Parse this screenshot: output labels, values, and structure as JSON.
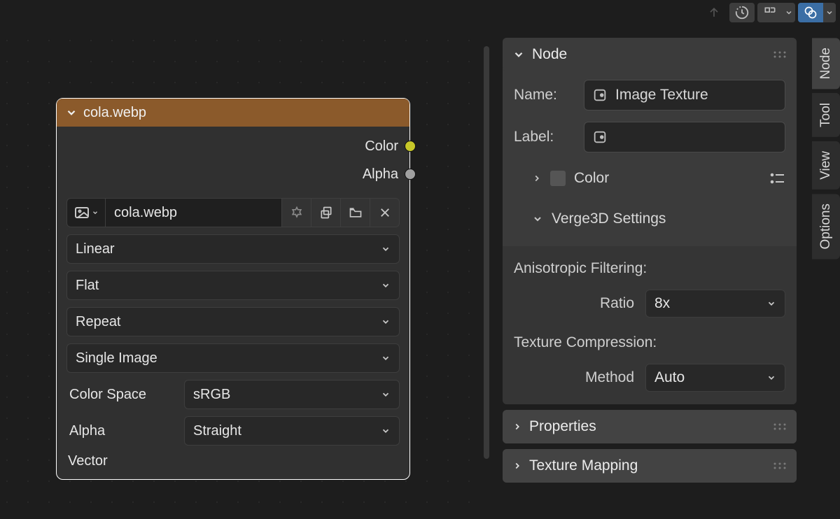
{
  "node": {
    "title": "cola.webp",
    "outputs": {
      "color": "Color",
      "alpha": "Alpha"
    },
    "image_field": "cola.webp",
    "interpolation": "Linear",
    "projection": "Flat",
    "extension": "Repeat",
    "source": "Single Image",
    "color_space_label": "Color Space",
    "color_space": "sRGB",
    "alpha_label": "Alpha",
    "alpha_mode": "Straight",
    "input_vector": "Vector"
  },
  "sidebar": {
    "node_panel": "Node",
    "name_label": "Name:",
    "name_value": "Image Texture",
    "label_label": "Label:",
    "label_value": "",
    "color_section": "Color",
    "verge3d_section": "Verge3D Settings",
    "aniso_title": "Anisotropic Filtering:",
    "aniso_ratio_label": "Ratio",
    "aniso_ratio_value": "8x",
    "tex_comp_title": "Texture Compression:",
    "tex_comp_method_label": "Method",
    "tex_comp_method_value": "Auto",
    "properties_panel": "Properties",
    "texmap_panel": "Texture Mapping"
  },
  "tabs": {
    "node": "Node",
    "tool": "Tool",
    "view": "View",
    "options": "Options"
  }
}
